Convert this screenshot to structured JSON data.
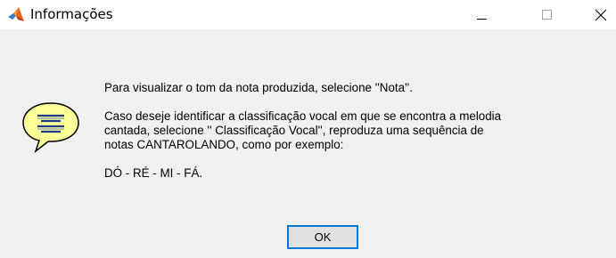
{
  "window": {
    "title": "Informações",
    "icon": "matlab-logo-icon"
  },
  "titlebar_buttons": {
    "minimize": "minimize-icon",
    "maximize": "maximize-icon",
    "close": "close-icon"
  },
  "dialog": {
    "icon": "help-speech-bubble-icon",
    "lines": [
      "Para visualizar o tom da nota produzida, selecione ''Nota''.",
      "Caso deseje identificar a classificação vocal em que se encontra a melodia",
      "cantada, selecione '' Classificação Vocal'', reproduza uma sequência de",
      "notas CANTAROLANDO, como por exemplo:",
      "DÓ - RÉ - MI - FÁ."
    ],
    "ok_label": "OK"
  },
  "colors": {
    "accent": "#0078d7",
    "bubble_fill": "#ffff99",
    "bubble_lines": "#1e3a8a"
  }
}
